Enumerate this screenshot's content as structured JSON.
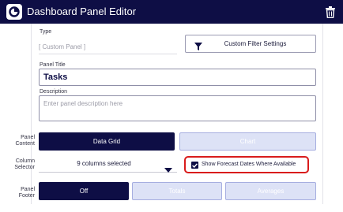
{
  "titlebar": {
    "title": "Dashboard Panel Editor",
    "app_icon": "app-logo-icon",
    "trash_icon": "trash-icon"
  },
  "type": {
    "label": "Type",
    "value": "[ Custom Panel ]"
  },
  "filter": {
    "label": "Custom Filter Settings",
    "icon": "filter-icon"
  },
  "panel_title": {
    "label": "Panel Title",
    "value": "Tasks"
  },
  "description": {
    "label": "Description",
    "placeholder": "Enter panel description here"
  },
  "panel_content": {
    "label_line1": "Panel",
    "label_line2": "Content",
    "options": [
      {
        "label": "Data Grid",
        "selected": true
      },
      {
        "label": "Chart",
        "selected": false
      }
    ]
  },
  "column_selector": {
    "label_line1": "Column",
    "label_line2": "Selector",
    "value": "9 columns selected",
    "icon": "chevron-down-icon"
  },
  "forecast": {
    "label": "Show Forecast Dates Where Available",
    "checked": true
  },
  "panel_footer": {
    "label_line1": "Panel",
    "label_line2": "Footer",
    "options": [
      {
        "label": "Off",
        "selected": true
      },
      {
        "label": "Totals",
        "selected": false
      },
      {
        "label": "Averages",
        "selected": false
      }
    ]
  },
  "colors": {
    "navy": "#0e0e45",
    "light_blue": "#dde2f6",
    "highlight_red": "#d91c1c"
  }
}
